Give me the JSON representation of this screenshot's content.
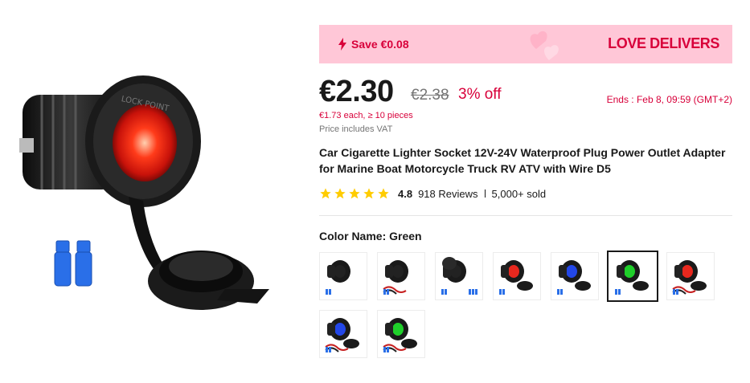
{
  "product_image": {
    "name": "Car cigarette lighter socket"
  },
  "banner": {
    "save_text": "Save €0.08",
    "brand_text": "LOVE DELIVERS"
  },
  "price": {
    "current": "€2.30",
    "original": "€2.38",
    "discount": "3% off",
    "ends": "Ends :  Feb 8, 09:59 (GMT+2)",
    "bulk": "€1.73 each, ≥ 10 pieces",
    "vat": "Price includes VAT"
  },
  "title": "Car Cigarette Lighter Socket 12V-24V Waterproof Plug Power Outlet Adapter for Marine Boat Motorcycle Truck RV ATV with Wire D5",
  "rating": {
    "stars": 5,
    "value": "4.8",
    "reviews": "918 Reviews",
    "sold": "5,000+ sold"
  },
  "color": {
    "label": "Color Name: Green"
  },
  "swatches": [
    {
      "glow": "#222222",
      "variant": "plain",
      "selected": false
    },
    {
      "glow": "#222222",
      "variant": "wire",
      "selected": false
    },
    {
      "glow": "#222222",
      "variant": "double",
      "selected": false
    },
    {
      "glow": "#e8281e",
      "variant": "cap",
      "selected": false
    },
    {
      "glow": "#2347e8",
      "variant": "cap",
      "selected": false
    },
    {
      "glow": "#1fcf2a",
      "variant": "cap",
      "selected": true
    },
    {
      "glow": "#e8281e",
      "variant": "capwire",
      "selected": false
    },
    {
      "glow": "#2347e8",
      "variant": "capwire",
      "selected": false
    },
    {
      "glow": "#1fcf2a",
      "variant": "capwire",
      "selected": false
    }
  ],
  "colors": {
    "accent": "#d8003a",
    "banner_bg": "#ffc7d7",
    "star": "#ffcc00"
  }
}
